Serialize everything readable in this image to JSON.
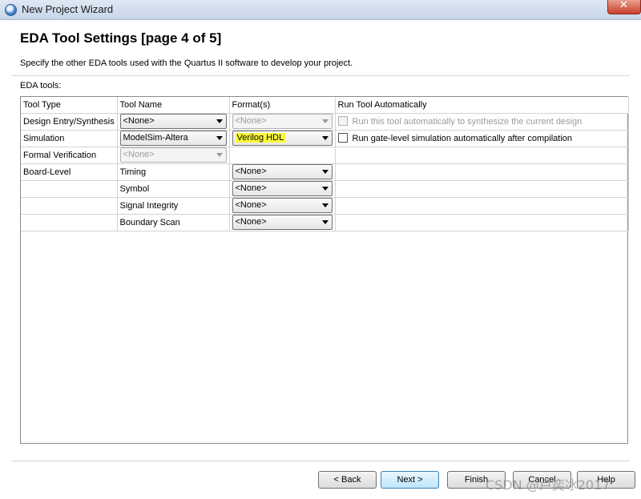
{
  "window": {
    "title": "New Project Wizard"
  },
  "header": {
    "page_title": "EDA Tool Settings [page 4 of 5]",
    "subtitle": "Specify the other EDA tools used with the Quartus II software to develop your project."
  },
  "eda_label": "EDA tools:",
  "table": {
    "columns": [
      "Tool Type",
      "Tool Name",
      "Format(s)",
      "Run Tool Automatically"
    ],
    "rows": [
      {
        "type": "Design Entry/Synthesis",
        "tool": "<None>",
        "format": "<None>",
        "run": "Run this tool automatically to synthesize the current design"
      },
      {
        "type": "Simulation",
        "tool": "ModelSim-Altera",
        "format": "Verilog HDL",
        "run": "Run gate-level simulation automatically after compilation"
      },
      {
        "type": "Formal Verification",
        "tool": "<None>"
      },
      {
        "type": "Board-Level",
        "tool": "Timing",
        "format": "<None>"
      },
      {
        "tool": "Symbol",
        "format": "<None>"
      },
      {
        "tool": "Signal Integrity",
        "format": "<None>"
      },
      {
        "tool": "Boundary Scan",
        "format": "<None>"
      }
    ]
  },
  "buttons": {
    "back": "< Back",
    "next": "Next >",
    "finish": "Finish",
    "cancel": "Cancel",
    "help": "Help"
  },
  "watermark": "CSDN @卢奕冰2017",
  "colors": {
    "highlight": "#fbfb3a",
    "default_button": "#bee6fd"
  }
}
